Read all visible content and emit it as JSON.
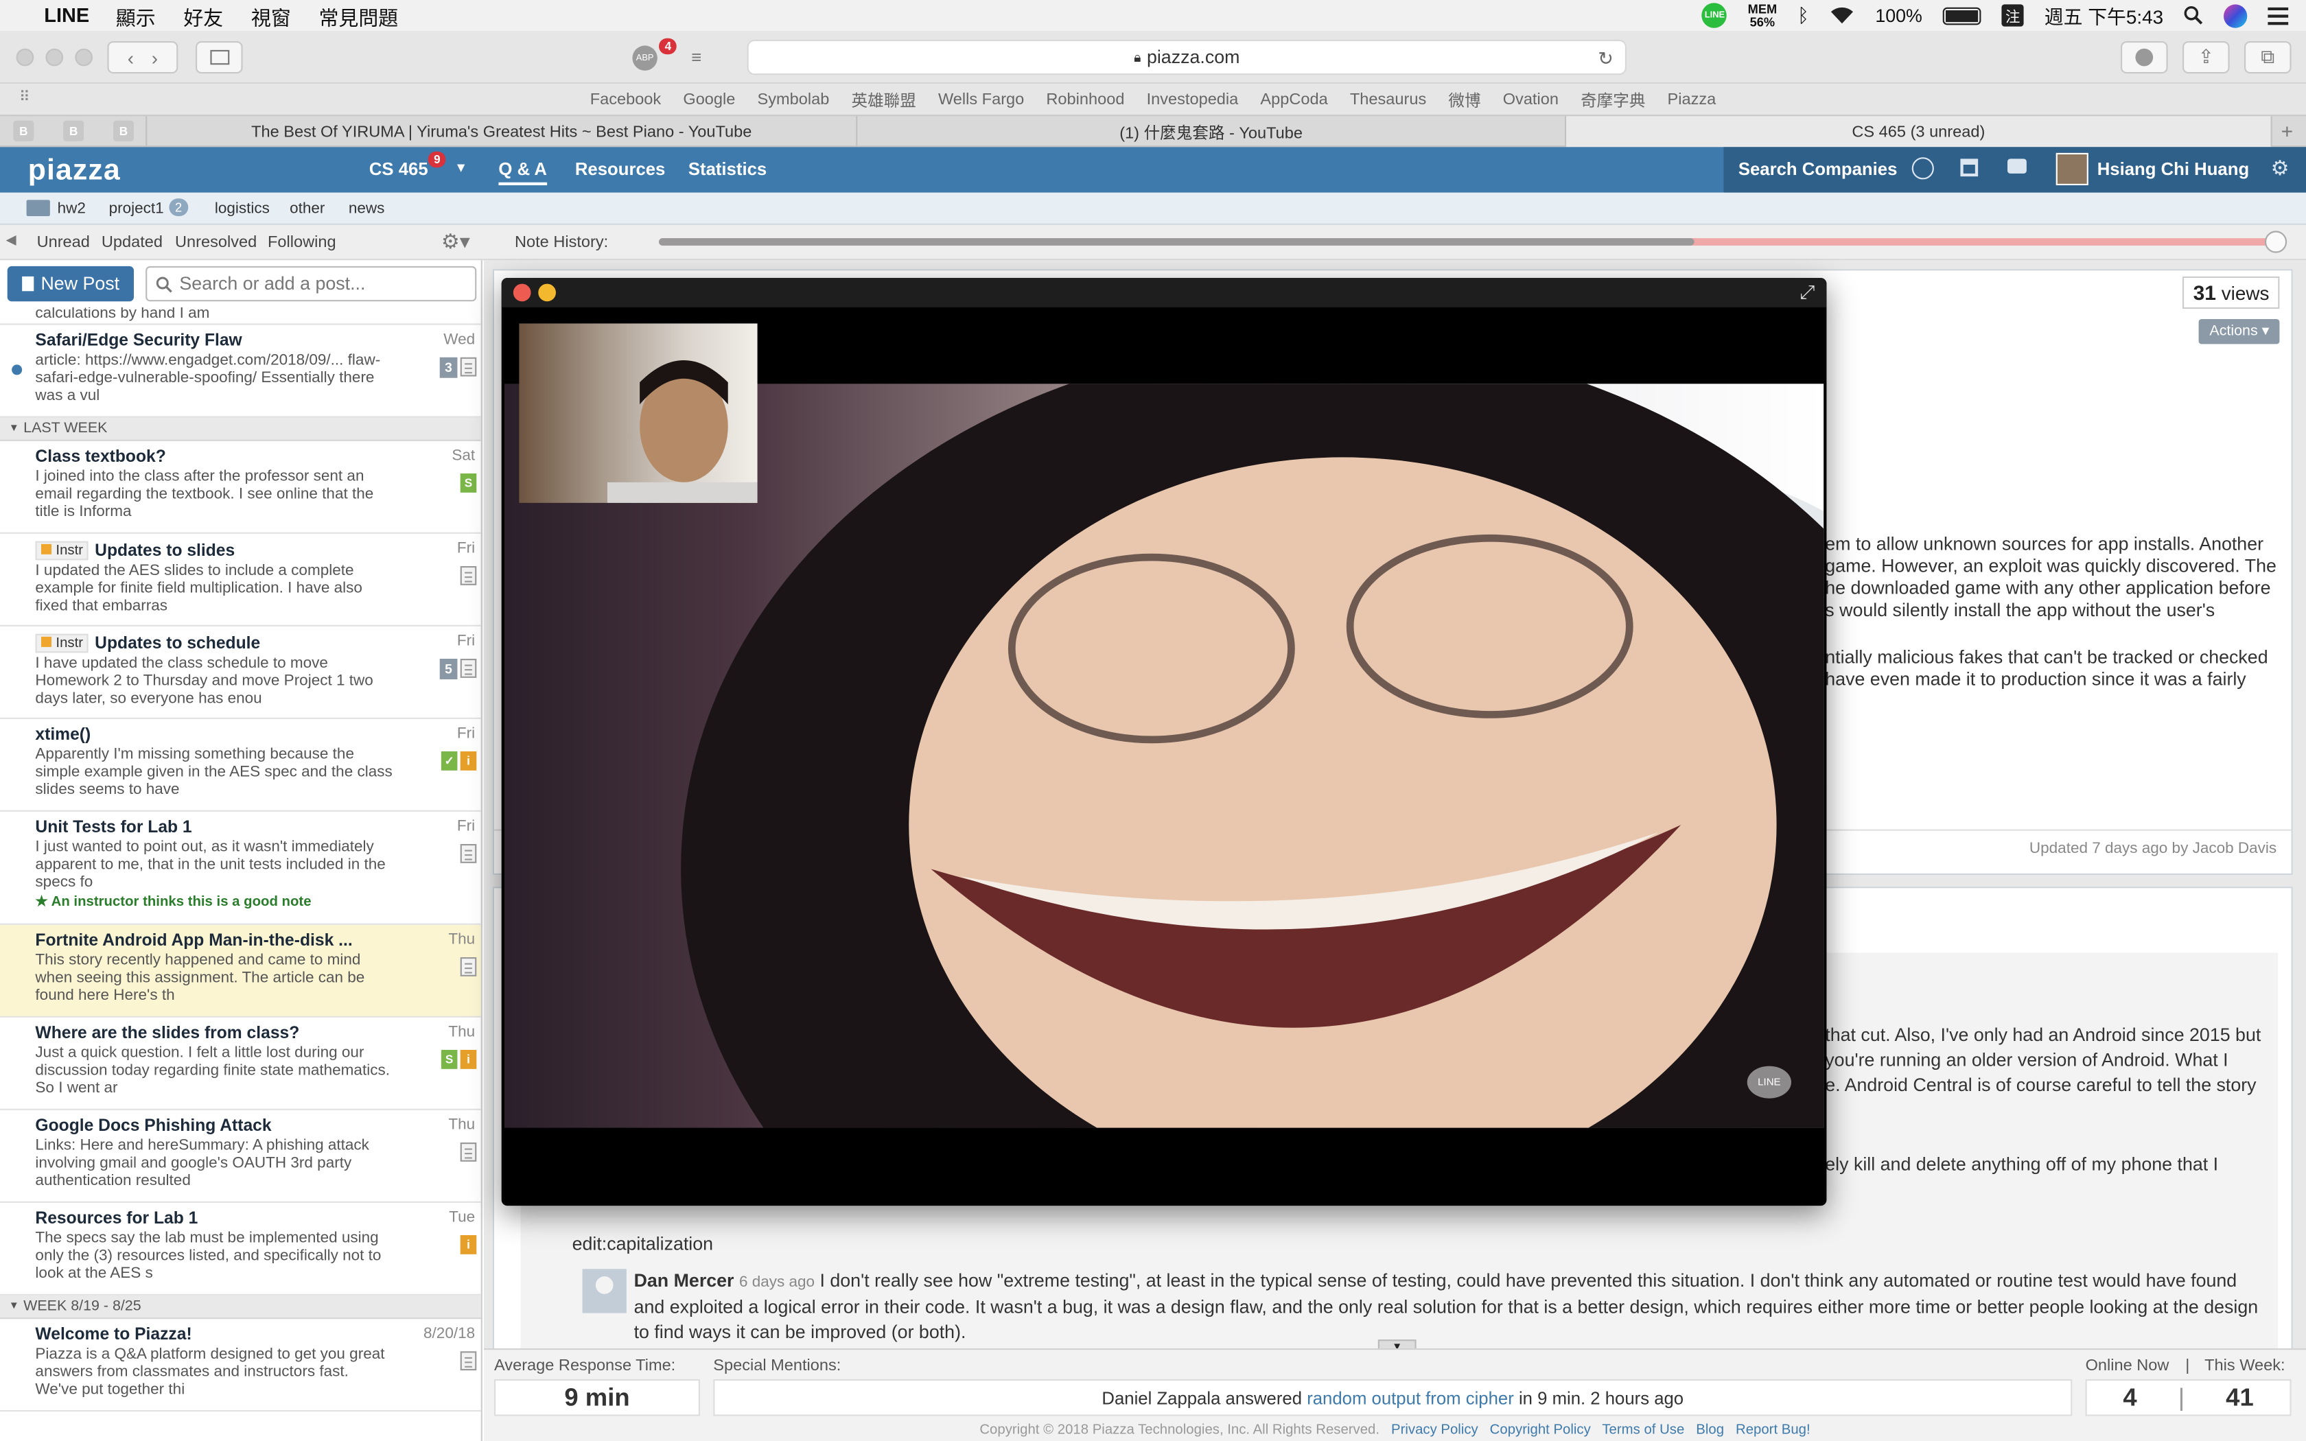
{
  "menubar": {
    "app": "LINE",
    "items": [
      "顯示",
      "好友",
      "視窗",
      "常見問題"
    ],
    "mem_label": "MEM",
    "mem_value": "56%",
    "battery": "100%",
    "ime": "注",
    "clock": "週五 下午5:43"
  },
  "browser": {
    "url": "piazza.com",
    "abp_count": "4",
    "favorites": [
      "Facebook",
      "Google",
      "Symbolab",
      "英雄聯盟",
      "Wells Fargo",
      "Robinhood",
      "Investopedia",
      "AppCoda",
      "Thesaurus",
      "微博",
      "Ovation",
      "奇摩字典",
      "Piazza"
    ],
    "pinned": [
      "B",
      "B",
      "B"
    ],
    "tabs": [
      "The Best Of YIRUMA | Yiruma's Greatest Hits ~ Best Piano - YouTube",
      "(1) 什麼鬼套路 - YouTube",
      "CS 465 (3 unread)"
    ]
  },
  "nav": {
    "logo": "piazza",
    "course": "CS 465",
    "course_badge": "9",
    "links": [
      "Q & A",
      "Resources",
      "Statistics"
    ],
    "search_companies": "Search Companies",
    "user": "Hsiang Chi Huang"
  },
  "folders": [
    "hw2",
    "project1",
    "logistics",
    "other",
    "news"
  ],
  "folder_badge": "2",
  "filters": [
    "Unread",
    "Updated",
    "Unresolved",
    "Following"
  ],
  "note_history_label": "Note History:",
  "note_history_position": 0.64,
  "left": {
    "new_post": "New Post",
    "search_placeholder": "Search or add a post...",
    "partial_top": "calculations by hand I am"
  },
  "feed": {
    "safari": {
      "title": "Safari/Edge Security Flaw",
      "body": "article: https://www.engadget.com/2018/09/... flaw-safari-edge-vulnerable-spoofing/ Essentially there was a vul",
      "date": "Wed",
      "count": "3"
    },
    "group_last_week": "LAST WEEK",
    "posts": [
      {
        "title": "Class textbook?",
        "body": "I joined into the class after the professor sent an email regarding the textbook. I see online that the title is Informa",
        "date": "Sat",
        "tag": "S"
      },
      {
        "instr": "Instr",
        "title": "Updates to slides",
        "body": "I updated the AES slides to include a complete example for finite field multiplication. I have also fixed that embarras",
        "date": "Fri"
      },
      {
        "instr": "Instr",
        "title": "Updates to schedule",
        "body": "I have updated the class schedule to move Homework 2 to Thursday and move Project 1 two days later, so everyone has enou",
        "date": "Fri",
        "count": "5"
      },
      {
        "title": "xtime()",
        "body": "Apparently I'm missing something because the simple example given in the AES spec and the class slides seems to have",
        "date": "Fri"
      },
      {
        "title": "Unit Tests for Lab 1",
        "body": "I just wanted to point out, as it wasn't immediately apparent to me, that in the unit tests included in the specs fo",
        "date": "Fri",
        "good_note": "An instructor thinks this is a good note"
      },
      {
        "title": "Fortnite Android App Man-in-the-disk ...",
        "body": "This story recently happened and came to mind when seeing this assignment. The article can be found here Here's th",
        "date": "Thu"
      },
      {
        "title": "Where are the slides from class?",
        "body": "Just a quick question. I felt a little lost during our discussion today regarding finite state mathematics. So I went ar",
        "date": "Thu"
      },
      {
        "title": "Google Docs Phishing Attack",
        "body": "Links:  Here and hereSummary: A phishing attack involving gmail and google's OAUTH 3rd party authentication resulted",
        "date": "Thu"
      },
      {
        "title": "Resources for Lab 1",
        "body": "The specs say the lab must be implemented using only the (3) resources listed, and specifically not to look at the AES s",
        "date": "Tue"
      }
    ],
    "group_week": "WEEK 8/19 - 8/25",
    "welcome": {
      "title": "Welcome to Piazza!",
      "body": "Piazza is a Q&A platform designed to get you great answers from classmates and instructors fast. We've put together thi",
      "date": "8/20/18"
    }
  },
  "question": {
    "views": "31",
    "views_label": "views",
    "actions": "Actions",
    "lines": [
      "em to allow unknown sources for app installs. Another",
      "game. However, an exploit was quickly discovered. The",
      "he downloaded game with any other application before",
      "s would silently install the app without the user's"
    ],
    "lines2": [
      "ntially malicious fakes that can't be tracked or checked",
      "have even made it to production since it was a fairly"
    ],
    "updated": "Updated 7 days ago by Jacob Davis"
  },
  "followup": {
    "lines": [
      "that cut. Also, I've only had an Android since 2015 but",
      "you're running an older version of Android. What I",
      "e. Android Central is of course careful to tell the story"
    ],
    "line_kill": "ely kill and delete anything off of my phone that I",
    "edit": "edit:capitalization",
    "reply_author": "Dan Mercer",
    "reply_time": "6 days ago",
    "reply_text": "I don't really see how \"extreme testing\", at least in the typical sense of testing, could have prevented this situation. I don't think any automated or routine test would have found and exploited a logical error in their code. It wasn't a bug, it was a design flaw, and the only real solution for that is a better design, which requires either more time or better people looking at the design to find ways it can be improved (or both)."
  },
  "footer": {
    "avg_label": "Average Response Time:",
    "avg_value": "9 min",
    "mentions_label": "Special Mentions:",
    "mention_pre": "Daniel Zappala answered",
    "mention_link": "random output from cipher",
    "mention_post": "in 9 min. 2 hours ago",
    "online_label": "Online Now",
    "week_label": "This Week:",
    "online_value": "4",
    "week_value": "41",
    "copyright": "Copyright © 2018 Piazza Technologies, Inc. All Rights Reserved.",
    "links": [
      "Privacy Policy",
      "Copyright Policy",
      "Terms of Use",
      "Blog",
      "Report Bug!"
    ]
  },
  "video": {
    "watermark": "LINE"
  }
}
